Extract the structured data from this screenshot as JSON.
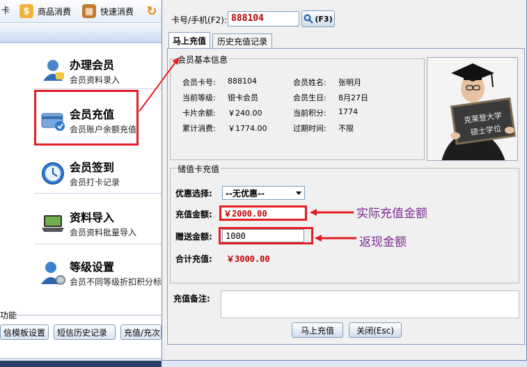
{
  "app": {
    "toolbar": {
      "card_fragment": "卡",
      "goods_consume": "商品消费",
      "quick_consume": "快速消费"
    },
    "menu": [
      {
        "title": "办理会员",
        "sub": "会员资料录入"
      },
      {
        "title": "会员充值",
        "sub": "会员账户余额充值"
      },
      {
        "title": "会员签到",
        "sub": "会员打卡记录"
      },
      {
        "title": "资料导入",
        "sub": "会员资料批量导入"
      },
      {
        "title": "等级设置",
        "sub": "会员不同等级折扣积分标"
      }
    ],
    "func_label": "功能",
    "bottom_buttons": [
      "信模板设置",
      "短信历史记录",
      "充值/充次"
    ]
  },
  "dialog": {
    "card_label": "卡号/手机(F2):",
    "card_value": "888104",
    "search_label": "(F3)",
    "tabs": [
      "马上充值",
      "历史充值记录"
    ],
    "info_group_title": "会员基本信息",
    "info": {
      "card_no_label": "会员卡号:",
      "card_no": "888104",
      "name_label": "会员姓名:",
      "name": "张明月",
      "level_label": "当前等级:",
      "level": "银卡会员",
      "birthday_label": "会员生日:",
      "birthday": "8月27日",
      "balance_label": "卡片余额:",
      "balance": "￥240.00",
      "points_label": "当前积分:",
      "points": "1774",
      "total_label": "累计消费:",
      "total": "￥1774.00",
      "expire_label": "过期时间:",
      "expire": "不限"
    },
    "photo_board": [
      "克莱登大学",
      "硕士学位"
    ],
    "recharge_group_title": "储值卡充值",
    "discount_label": "优惠选择:",
    "discount_value": "--无优惠--",
    "amount_label": "充值金额:",
    "amount_value": "￥2000.00",
    "bonus_label": "赠送金额:",
    "bonus_value": "1000",
    "sum_label": "合计充值:",
    "sum_value": "￥3000.00",
    "memo_label": "充值备注:",
    "confirm_button": "马上充值",
    "close_button": "关闭(Esc)"
  },
  "annotations": {
    "amount_note": "实际充值金额",
    "bonus_note": "返现金额"
  },
  "colors": {
    "highlight_red": "#e21d23",
    "value_red": "#c00000",
    "annotation_purple": "#7a2a8f"
  }
}
